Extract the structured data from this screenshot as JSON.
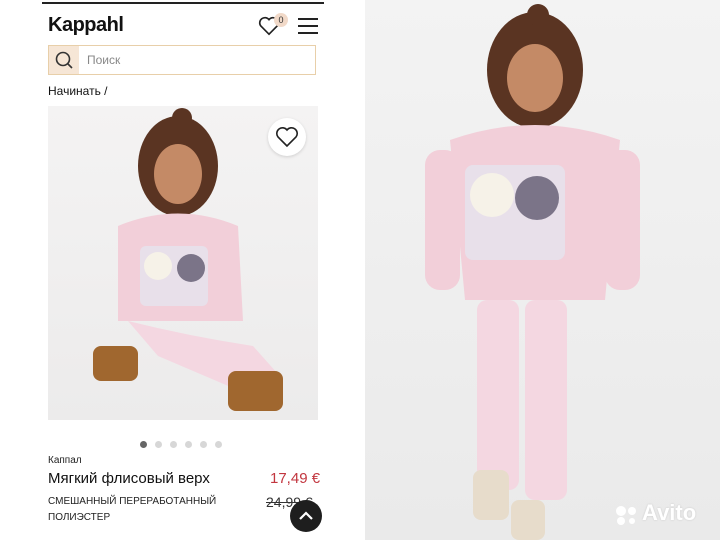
{
  "header": {
    "logo_text": "Kappahl",
    "wishlist_count": "0"
  },
  "search": {
    "placeholder": "Поиск"
  },
  "breadcrumb": {
    "label": "Начинать /"
  },
  "gallery": {
    "slide_count": 6,
    "active_slide": 1
  },
  "product": {
    "brand": "Каппал",
    "name": "Мягкий флисовый верх",
    "price_new": "17,49 €",
    "price_old": "24,99 €",
    "material": "СМЕШАННЫЙ ПЕРЕРАБОТАННЫЙ ПОЛИЭСТЕР"
  },
  "watermark": {
    "text": "Avito"
  },
  "colors": {
    "price_sale": "#c2363f",
    "search_border": "#e8cfa9",
    "search_button_bg": "#f6e6d6",
    "sweater_pink": "#f2cfd9"
  }
}
